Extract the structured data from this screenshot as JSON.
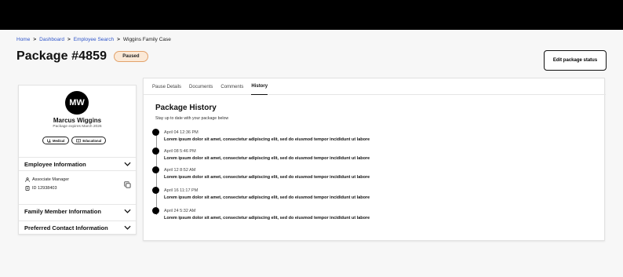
{
  "breadcrumb": [
    {
      "label": "Home",
      "link": true
    },
    {
      "label": "Dashboard",
      "link": true
    },
    {
      "label": "Employee Search",
      "link": true
    },
    {
      "label": "Wiggins Family Case",
      "link": false
    }
  ],
  "header": {
    "title": "Package #4859",
    "status": "Paused",
    "edit_label": "Edit package status"
  },
  "profile": {
    "initials": "MW",
    "name": "Marcus Wiggins",
    "subtitle": "Package expires March 2026",
    "tags": [
      {
        "label": "Medical",
        "icon": "stethoscope-icon"
      },
      {
        "label": "Educational",
        "icon": "book-icon"
      }
    ],
    "employee_info_label": "Employee Information",
    "role": "Associate Manager",
    "employee_id": "ID 12938403",
    "family_label": "Family Member Information",
    "contact_label": "Preferred Contact Information"
  },
  "tabs": [
    {
      "label": "Pause Details",
      "active": false
    },
    {
      "label": "Documents",
      "active": false
    },
    {
      "label": "Comments",
      "active": false
    },
    {
      "label": "History",
      "active": true
    }
  ],
  "history": {
    "title": "Package History",
    "subtitle": "Stay up to date with your package below",
    "events": [
      {
        "time": "April 04 12:36 PM",
        "text": "Lorem ipsum dolor sit amet, consectetur adipiscing elit, sed do eiusmod tempor incididunt ut labore"
      },
      {
        "time": "April 08 5:46 PM",
        "text": "Lorem ipsum dolor sit amet, consectetur adipiscing elit, sed do eiusmod tempor incididunt ut labore"
      },
      {
        "time": "April 12 8:52 AM",
        "text": "Lorem ipsum dolor sit amet, consectetur adipiscing elit, sed do eiusmod tempor incididunt ut labore"
      },
      {
        "time": "April 16 11:17 PM",
        "text": "Lorem ipsum dolor sit amet, consectetur adipiscing elit, sed do eiusmod tempor incididunt ut labore"
      },
      {
        "time": "April 24 5:32 AM",
        "text": "Lorem ipsum dolor sit amet, consectetur adipiscing elit, sed do eiusmod tempor incididunt ut labore"
      }
    ]
  },
  "colors": {
    "link": "#2f55c9",
    "badge_bg": "#fbe9d7",
    "badge_border": "#e3a26b"
  }
}
